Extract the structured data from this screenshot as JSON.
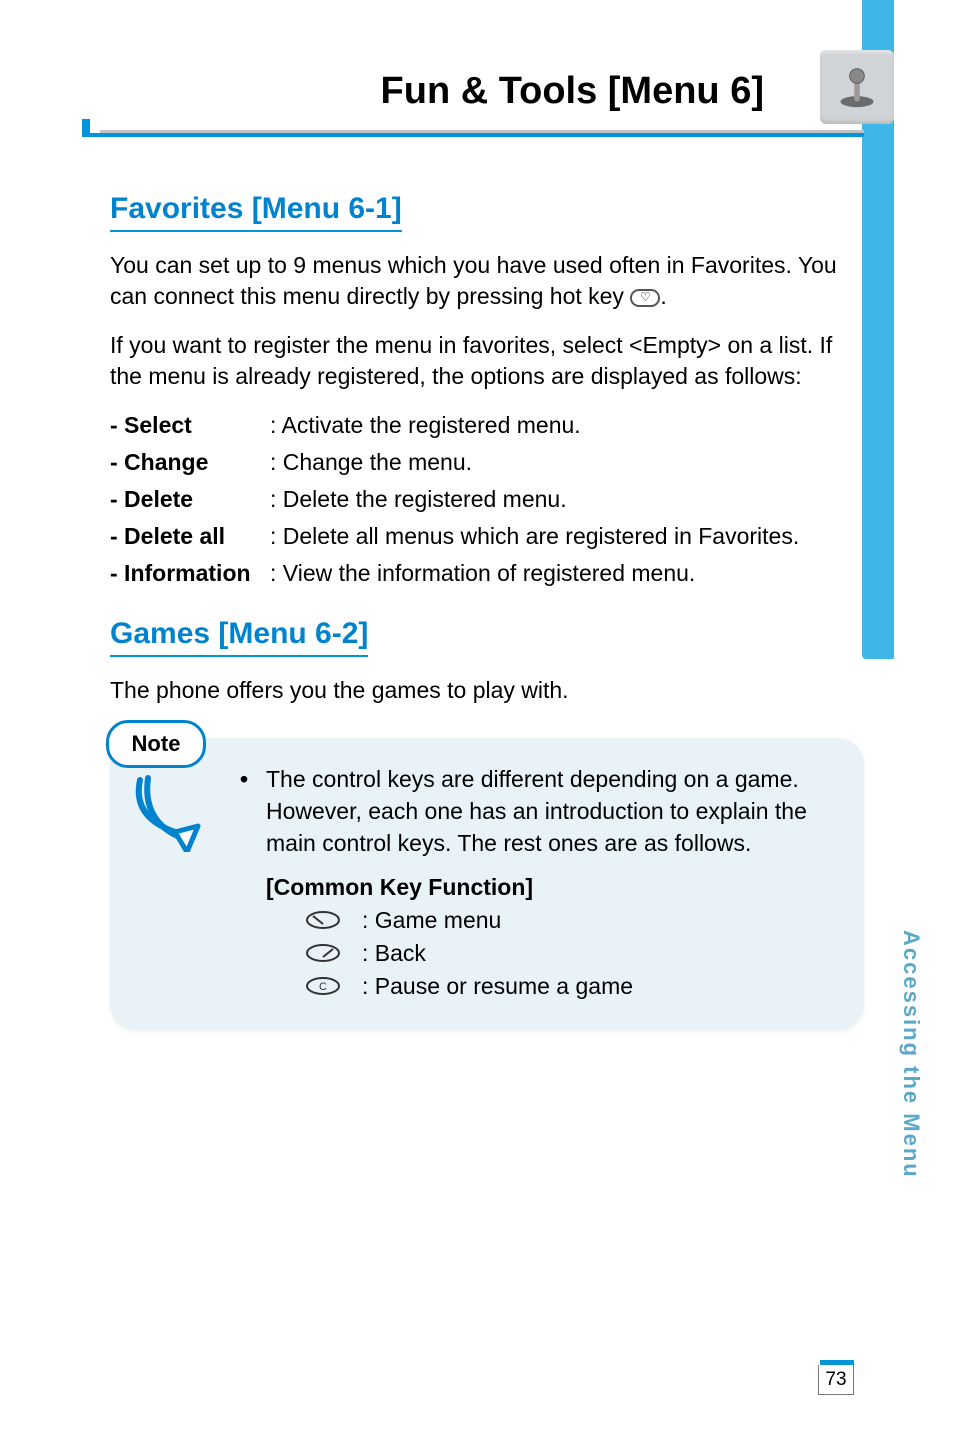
{
  "header": {
    "page_title": "Fun & Tools [Menu 6]"
  },
  "favorites": {
    "heading": "Favorites [Menu 6-1]",
    "intro1": "You can set up to 9 menus which you have used often in Favorites. You can connect this menu directly by pressing hot key ",
    "intro1_suffix": ".",
    "intro2": "If you want to register the menu in favorites, select <Empty> on a list. If the menu is already registered, the options are displayed as follows:",
    "items": [
      {
        "term": "- Select",
        "desc": ": Activate the registered menu."
      },
      {
        "term": "- Change",
        "desc": ": Change the menu."
      },
      {
        "term": "- Delete",
        "desc": ": Delete the registered menu."
      },
      {
        "term": "- Delete all",
        "desc": ": Delete all menus  which are registered in Favorites."
      },
      {
        "term": "- Information",
        "desc": ": View the information of registered menu."
      }
    ]
  },
  "games": {
    "heading": "Games [Menu 6-2]",
    "intro": "The phone offers you the games to play with."
  },
  "note": {
    "badge": "Note",
    "bullet": "The control keys are different depending on a game. However, each one has an introduction to explain the main control keys. The rest ones are as follows.",
    "sub_heading": "[Common Key Function]",
    "keys": [
      {
        "icon": "left-softkey-icon",
        "desc": ": Game menu"
      },
      {
        "icon": "right-softkey-icon",
        "desc": ": Back"
      },
      {
        "icon": "c-key-icon",
        "label": "C",
        "desc": ": Pause or resume a game"
      }
    ]
  },
  "side": {
    "vertical_label": "Accessing the Menu",
    "page_number": "73"
  }
}
